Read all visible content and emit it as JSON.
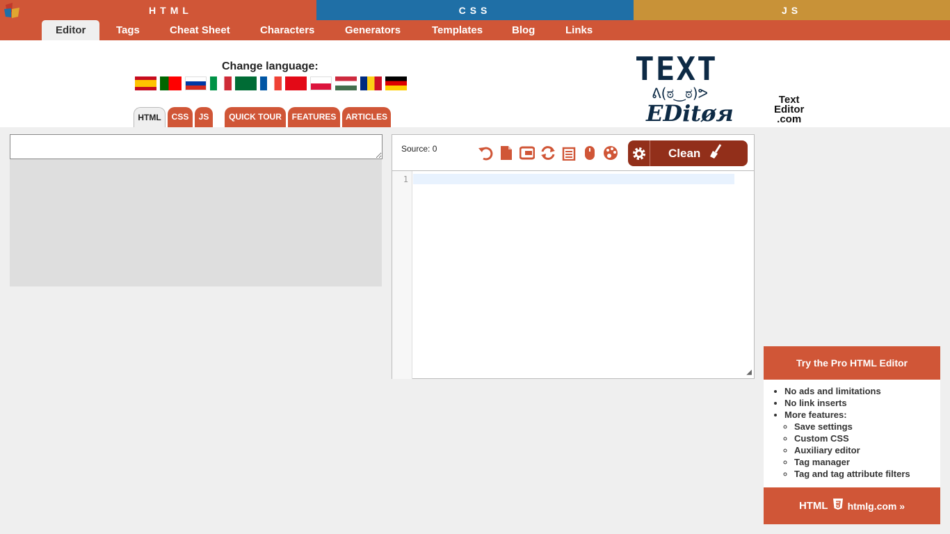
{
  "topbar": {
    "html_label": "HTML",
    "css_label": "CSS",
    "js_label": "JS"
  },
  "nav": [
    {
      "label": "Editor"
    },
    {
      "label": "Tags"
    },
    {
      "label": "Cheat Sheet"
    },
    {
      "label": "Characters"
    },
    {
      "label": "Generators"
    },
    {
      "label": "Templates"
    },
    {
      "label": "Blog"
    },
    {
      "label": "Links"
    }
  ],
  "language": {
    "label": "Change language:",
    "flags": [
      "spanish-flag-icon",
      "portuguese-flag-icon",
      "russian-flag-icon",
      "italian-flag-icon",
      "arabic-flag-icon",
      "french-flag-icon",
      "turkish-flag-icon",
      "polish-flag-icon",
      "hungarian-flag-icon",
      "romanian-flag-icon",
      "german-flag-icon"
    ]
  },
  "tabs": [
    {
      "label": "HTML"
    },
    {
      "label": "CSS"
    },
    {
      "label": "JS"
    },
    {
      "label": "QUICK TOUR"
    },
    {
      "label": "FEATURES"
    },
    {
      "label": "ARTICLES"
    }
  ],
  "logo": {
    "line1": "Text",
    "line2": "Editor",
    "line3": ".com",
    "art_top": "TEXT",
    "art_face": "ᕕ(ಠ‿ಠ)ᕗ",
    "art_bottom": "EDitøя"
  },
  "editor": {
    "source_label": "Source: 0",
    "clean_label": "Clean",
    "line_number": "1"
  },
  "pro": {
    "title": "Try the Pro HTML Editor",
    "items": [
      "No ads and limitations",
      "No link inserts",
      "More features:"
    ],
    "subitems": [
      "Save settings",
      "Custom CSS",
      "Auxiliary editor",
      "Tag manager",
      "Tag and tag attribute filters"
    ],
    "footer_badge": "HTML",
    "footer_link": "htmlg.com »"
  },
  "colors": {
    "accent": "#d05637",
    "css_blue": "#1f6fa6",
    "js_gold": "#c89238",
    "clean_dark": "#922f1a"
  }
}
